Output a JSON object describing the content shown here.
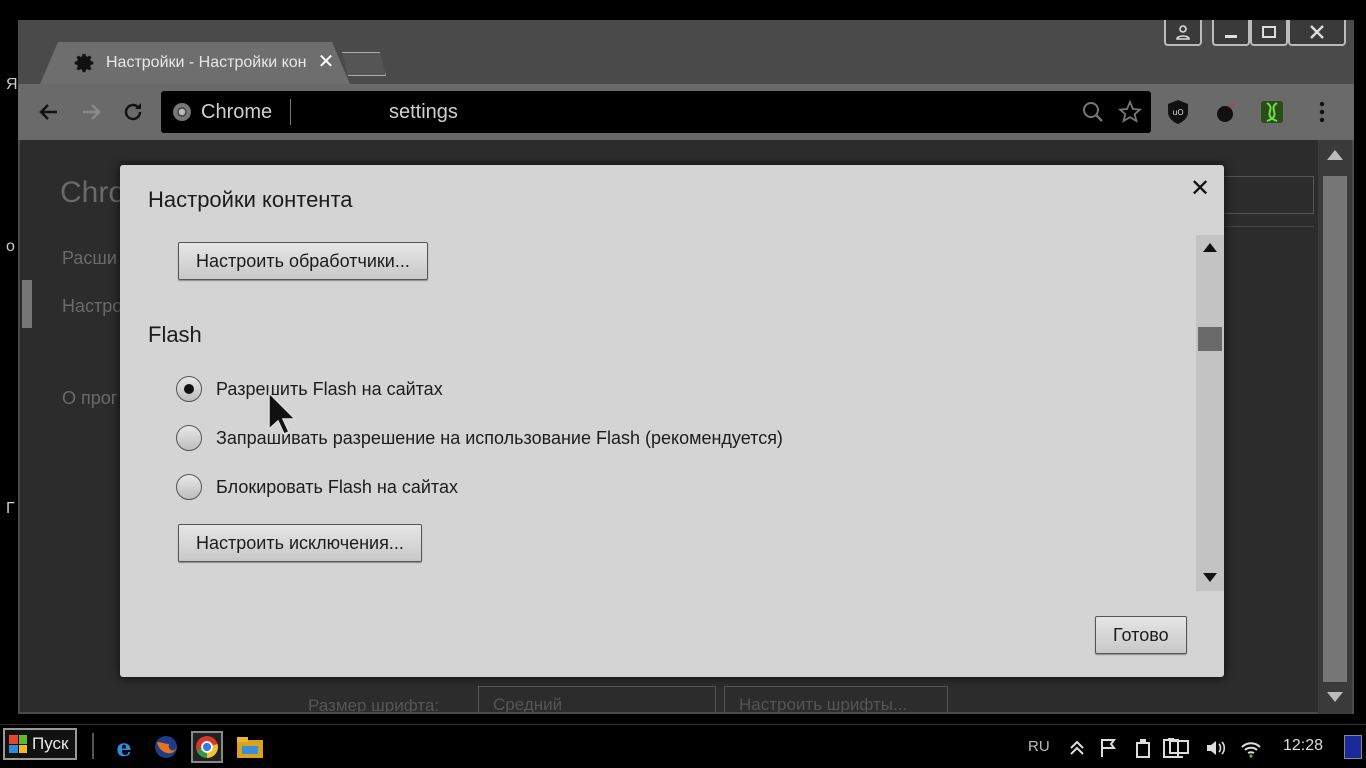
{
  "desktop": {
    "edge_letters": [
      "Я",
      "о",
      "Г"
    ]
  },
  "browser": {
    "tab_title": "Настройки - Настройки контента",
    "tab_close_glyph": "✕",
    "omnibox": {
      "chip": "Chrome",
      "url": "settings"
    },
    "window_controls": [
      "account-icon",
      "minimize-icon",
      "restore-icon",
      "close-icon"
    ]
  },
  "page": {
    "title": "Chro",
    "nav": [
      "Расши",
      "Настро",
      "О прог"
    ],
    "font_size_label": "Размер шрифта:",
    "font_size_value": "Средний",
    "customize_fonts": "Настроить шрифты..."
  },
  "dialog": {
    "title": "Настройки контента",
    "close_glyph": "✕",
    "handlers_button": "Настроить обработчики...",
    "flash_section": "Flash",
    "options": [
      {
        "label": "Разрешить Flash на сайтах",
        "checked": true
      },
      {
        "label": "Запрашивать разрешение на использование Flash (рекомендуется)",
        "checked": false
      },
      {
        "label": "Блокировать Flash на сайтах",
        "checked": false
      }
    ],
    "exceptions_button": "Настроить исключения...",
    "done_button": "Готово"
  },
  "taskbar": {
    "start_label": "Пуск",
    "apps": [
      "ie-icon",
      "firefox-icon",
      "chrome-icon",
      "explorer-icon"
    ],
    "language": "RU",
    "time": "12:28"
  },
  "colors": {
    "dialog_bg": "#d4d4d4",
    "window_bg": "#4a4a4a",
    "toolbar_bg": "#6a6a6a"
  }
}
